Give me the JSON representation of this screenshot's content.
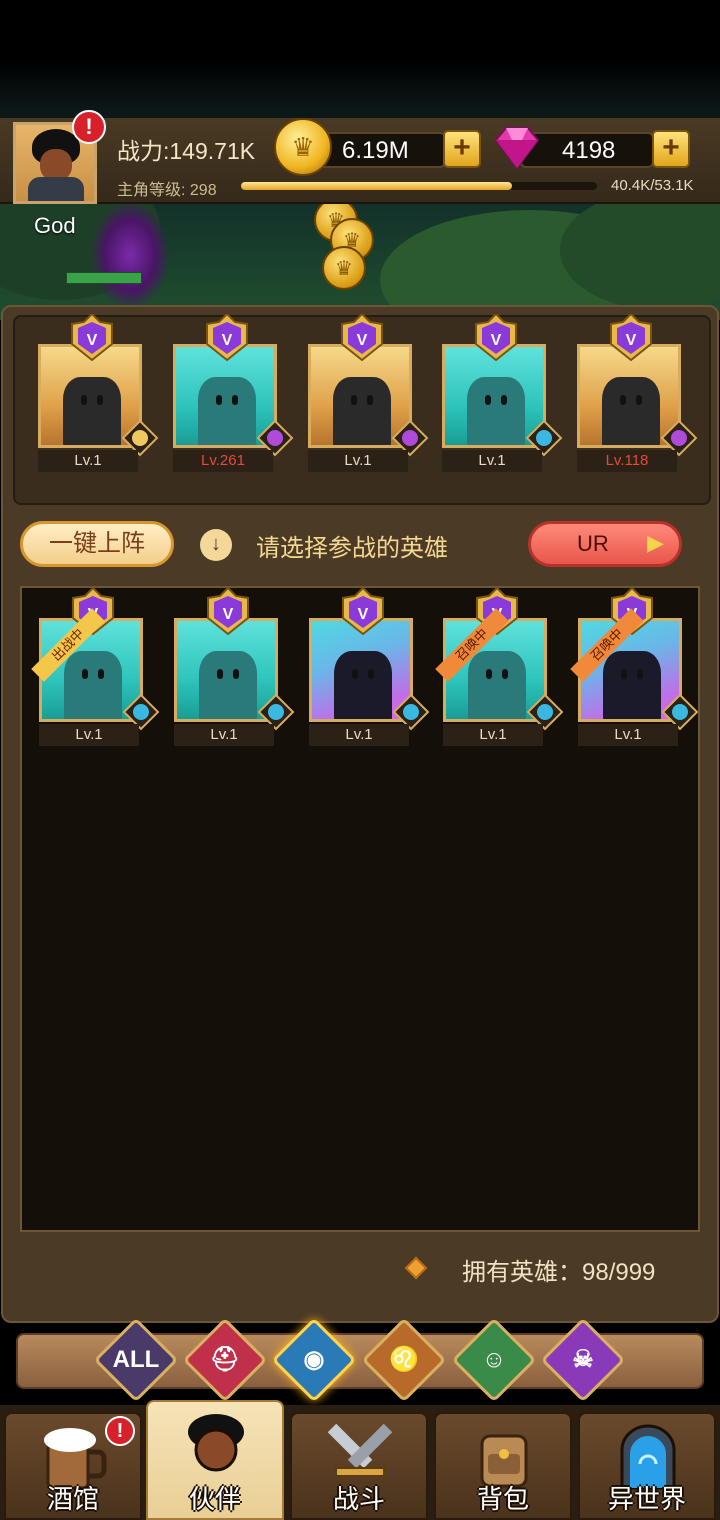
{
  "player": {
    "name": "God",
    "power_label": "战力:149.71K",
    "level_label": "主角等级: 298",
    "xp_text": "40.4K/53.1K",
    "xp_fraction": 0.762
  },
  "currency": {
    "gold": "6.19M",
    "gems": "4198"
  },
  "team": {
    "slots": [
      {
        "level": "Lv.1",
        "level_color": "normal",
        "bg": "gold",
        "element": "elf"
      },
      {
        "level": "Lv.261",
        "level_color": "red",
        "bg": "cyan",
        "element": "demon"
      },
      {
        "level": "Lv.1",
        "level_color": "normal",
        "bg": "gold",
        "element": "demon"
      },
      {
        "level": "Lv.1",
        "level_color": "normal",
        "bg": "cyan",
        "element": "sea"
      },
      {
        "level": "Lv.118",
        "level_color": "red",
        "bg": "gold",
        "element": "demon"
      }
    ]
  },
  "actions": {
    "auto_deploy": "一键上阵",
    "hint": "请选择参战的英雄",
    "rarity_filter": "UR"
  },
  "roster": {
    "heroes": [
      {
        "level": "Lv.1",
        "status": "出战中",
        "bg": "cyan"
      },
      {
        "level": "Lv.1",
        "status": "",
        "bg": "cyan"
      },
      {
        "level": "Lv.1",
        "status": "",
        "bg": "purple"
      },
      {
        "level": "Lv.1",
        "status": "召唤中",
        "bg": "cyan"
      },
      {
        "level": "Lv.1",
        "status": "召唤中",
        "bg": "purple"
      }
    ],
    "owned_label": "拥有英雄：98/999"
  },
  "filters": [
    "ALL",
    "knight-icon",
    "sea-icon",
    "lion-icon",
    "elf-icon",
    "demon-icon"
  ],
  "nav": {
    "tavern": "酒馆",
    "partner": "伙伴",
    "battle": "战斗",
    "bag": "背包",
    "otherworld": "异世界"
  },
  "colors": {
    "panel": "#4a3a26",
    "gold_accent": "#d7ac5e",
    "red_level": "#e64a3a"
  }
}
